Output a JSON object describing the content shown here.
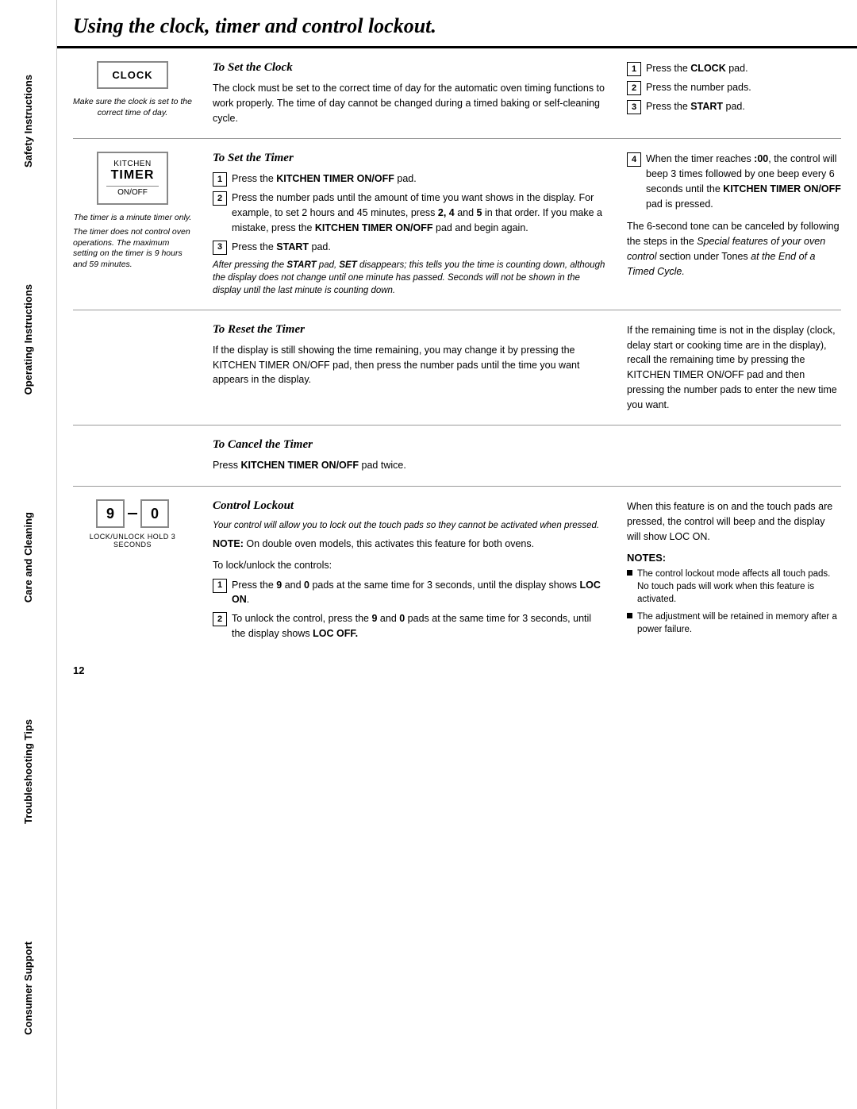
{
  "sidebar": {
    "items": [
      {
        "label": "Safety Instructions"
      },
      {
        "label": "Operating Instructions"
      },
      {
        "label": "Care and Cleaning"
      },
      {
        "label": "Troubleshooting Tips"
      },
      {
        "label": "Consumer Support"
      }
    ]
  },
  "page": {
    "title": "Using the clock, timer and control lockout.",
    "page_number": "12"
  },
  "set_clock": {
    "title": "To Set the Clock",
    "image_label": "CLOCK",
    "caption": "Make sure the clock is set to the correct time of day.",
    "body": "The clock must be set to the correct time of day for the automatic oven timing functions to work properly. The time of day cannot be changed during a timed baking or self-cleaning cycle.",
    "steps": [
      {
        "num": "1",
        "text_before": "Press the ",
        "bold": "CLOCK",
        "text_after": " pad."
      },
      {
        "num": "2",
        "text": "Press the number pads."
      },
      {
        "num": "3",
        "text_before": "Press the ",
        "bold": "START",
        "text_after": " pad."
      }
    ]
  },
  "set_timer": {
    "title": "To Set the Timer",
    "image_top": "KITCHEN",
    "image_main": "TIMER",
    "image_bottom": "ON/OFF",
    "caption1": "The timer is a minute timer only.",
    "caption2": "The timer does not control oven operations. The maximum setting on the timer is 9 hours and 59 minutes.",
    "steps_left": [
      {
        "num": "1",
        "text_before": "Press the ",
        "bold": "KITCHEN TIMER ON/OFF",
        "text_after": " pad."
      },
      {
        "num": "2",
        "text": "Press the number pads until the amount of time you want shows in the display. For example, to set 2 hours and 45 minutes, press 2, 4 and 5 in that order. If you make a mistake, press the KITCHEN TIMER ON/OFF pad and begin again."
      },
      {
        "num": "3",
        "text_before": "Press the ",
        "bold": "START",
        "text_after": " pad."
      }
    ],
    "italic_note": "After pressing the START pad, SET disappears; this tells you the time is counting down, although the display does not change until one minute has passed. Seconds will not be shown in the display until the last minute is counting down.",
    "step4": "When the timer reaches :00, the control will beep 3 times followed by one beep every 6 seconds until the KITCHEN TIMER ON/OFF pad is pressed.",
    "cancel_note": "The 6-second tone can be canceled by following the steps in the Special features of your oven control section under Tones at the End of a Timed Cycle."
  },
  "reset_timer": {
    "title": "To Reset the Timer",
    "left_text": "If the display is still showing the time remaining, you may change it by pressing the KITCHEN TIMER ON/OFF pad, then press the number pads until the time you want appears in the display.",
    "right_text": "If the remaining time is not in the display (clock, delay start or cooking time are in the display), recall the remaining time by pressing the KITCHEN TIMER ON/OFF pad and then pressing the number pads to enter the new time you want."
  },
  "cancel_timer": {
    "title": "To Cancel the Timer",
    "text_before": "Press ",
    "bold": "KITCHEN TIMER ON/OFF",
    "text_after": " pad twice."
  },
  "control_lockout": {
    "title": "Control Lockout",
    "pad_num1": "9",
    "pad_num2": "0",
    "pad_caption": "LOCK/UNLOCK HOLD 3 SECONDS",
    "italic_intro": "Your control will allow you to lock out the touch pads so they cannot be activated when pressed.",
    "note_text": "NOTE: On double oven models, this activates this feature for both ovens.",
    "to_lock": "To lock/unlock the controls:",
    "steps": [
      {
        "num": "1",
        "text": "Press the 9 and 0 pads at the same time for 3 seconds, until the display shows LOC ON."
      },
      {
        "num": "2",
        "text": "To unlock the control, press the 9 and 0 pads at the same time for 3 seconds, until the display shows LOC OFF."
      }
    ],
    "right_intro": "When this feature is on and the touch pads are pressed, the control will beep and the display will show LOC ON.",
    "notes_label": "NOTES:",
    "bullets": [
      "The control lockout mode affects all touch pads. No touch pads will work when this feature is activated.",
      "The adjustment will be retained in memory after a power failure."
    ]
  }
}
